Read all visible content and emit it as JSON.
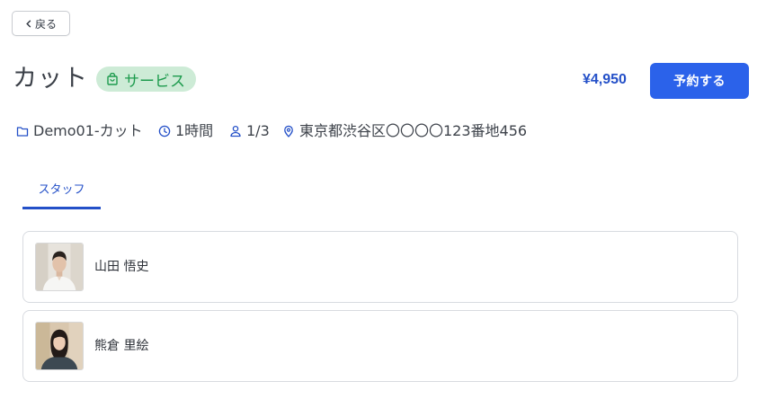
{
  "back": {
    "label": "戻る"
  },
  "service": {
    "title": "カット",
    "badge": "サービス",
    "price": "¥4,950",
    "book_label": "予約する"
  },
  "meta": {
    "category": "Demo01-カット",
    "duration": "1時間",
    "capacity": "1/3",
    "address": "東京都渋谷区〇〇〇〇123番地456"
  },
  "tabs": [
    {
      "label": "スタッフ",
      "active": true
    }
  ],
  "staff": [
    {
      "name": "山田 悟史",
      "photo": "man-in-white-shirt"
    },
    {
      "name": "熊倉 里絵",
      "photo": "woman-in-dark-top"
    }
  ],
  "colors": {
    "accent": "#2b62ea",
    "accent_text": "#2450c8",
    "badge_bg": "#cdebd6",
    "badge_text": "#1d9b4d"
  },
  "icons": {
    "back": "chevron-left-icon",
    "badge": "shopping-bag-icon",
    "category": "folder-icon",
    "duration": "clock-icon",
    "capacity": "user-icon",
    "address": "map-pin-icon"
  }
}
